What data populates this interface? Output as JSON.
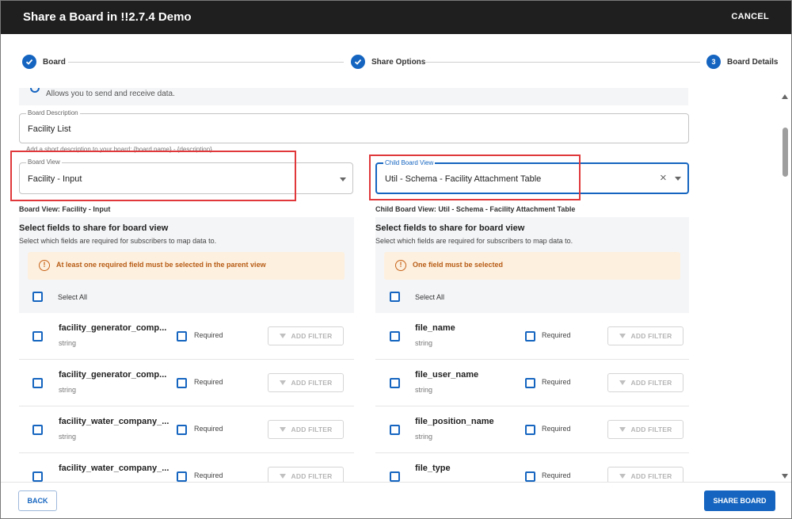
{
  "header": {
    "title": "Share a Board in !!2.7.4 Demo",
    "cancel_label": "CANCEL"
  },
  "stepper": {
    "steps": [
      {
        "label": "Board",
        "state": "completed"
      },
      {
        "label": "Share Options",
        "state": "completed"
      },
      {
        "number": "3",
        "label": "Board Details",
        "state": "active"
      }
    ]
  },
  "form": {
    "partial_option_text": "Allows you to send and receive data.",
    "description": {
      "label": "Board Description",
      "value": "Facility List",
      "helper": "Add a short description to your board: {board name} - {description}"
    },
    "board_view": {
      "label": "Board View",
      "value": "Facility - Input"
    },
    "child_board_view": {
      "label": "Child Board View",
      "value": "Util - Schema - Facility Attachment Table"
    }
  },
  "left_panel": {
    "caption": "Board View: Facility - Input",
    "title": "Select fields to share for board view",
    "subtitle": "Select which fields are required for subscribers to map data to.",
    "alert": "At least one required field must be selected in the parent view",
    "select_all": "Select All",
    "rows": [
      {
        "name": "facility_generator_comp...",
        "type": "string",
        "required": "Required",
        "filter": "ADD FILTER"
      },
      {
        "name": "facility_generator_comp...",
        "type": "string",
        "required": "Required",
        "filter": "ADD FILTER"
      },
      {
        "name": "facility_water_company_...",
        "type": "string",
        "required": "Required",
        "filter": "ADD FILTER"
      },
      {
        "name": "facility_water_company_...",
        "type": "",
        "required": "Required",
        "filter": "ADD FILTER"
      }
    ]
  },
  "right_panel": {
    "caption": "Child Board View: Util - Schema - Facility Attachment Table",
    "title": "Select fields to share for board view",
    "subtitle": "Select which fields are required for subscribers to map data to.",
    "alert": "One field must be selected",
    "select_all": "Select All",
    "rows": [
      {
        "name": "file_name",
        "type": "string",
        "required": "Required",
        "filter": "ADD FILTER"
      },
      {
        "name": "file_user_name",
        "type": "string",
        "required": "Required",
        "filter": "ADD FILTER"
      },
      {
        "name": "file_position_name",
        "type": "string",
        "required": "Required",
        "filter": "ADD FILTER"
      },
      {
        "name": "file_type",
        "type": "",
        "required": "Required",
        "filter": "ADD FILTER"
      }
    ]
  },
  "footer": {
    "back_label": "BACK",
    "share_label": "SHARE BOARD"
  },
  "colors": {
    "primary": "#1565c0",
    "header_bg": "#1f1f1f",
    "warning_bg": "#fdf0df",
    "warning_text": "#b75c15",
    "highlight": "#e0383b"
  }
}
